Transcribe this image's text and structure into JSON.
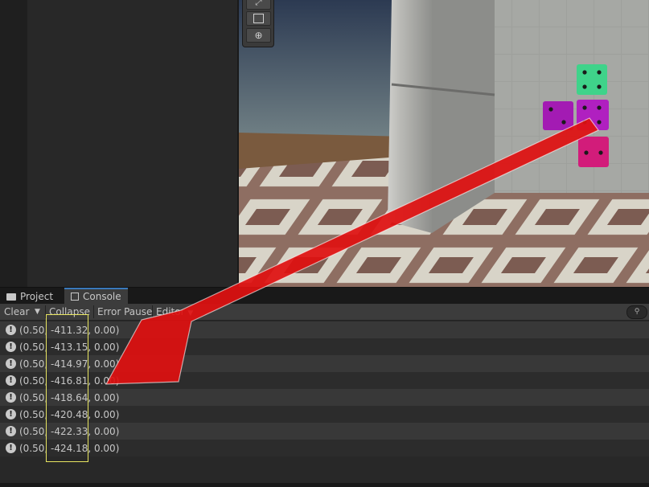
{
  "tabs": [
    {
      "label": "Project",
      "icon": "folder-icon"
    },
    {
      "label": "Console",
      "icon": "console-icon"
    }
  ],
  "toolbar": {
    "clear": "Clear",
    "collapse": "Collapse",
    "error_pause": "Error Pause",
    "editor": "Editor"
  },
  "log_entries": [
    "(0.50, -411.32, 0.00)",
    "(0.50, -413.15, 0.00)",
    "(0.50, -414.97, 0.00)",
    "(0.50, -416.81, 0.00)",
    "(0.50, -418.64, 0.00)",
    "(0.50, -420.48, 0.00)",
    "(0.50, -422.33, 0.00)",
    "(0.50, -424.18, 0.00)"
  ],
  "colors": {
    "annotation_arrow": "#e01010",
    "highlight_box": "#e8e560",
    "tab_accent": "#3a79bb",
    "dice_green": "#3fd38a",
    "dice_purple": "#b020c0",
    "dice_pink": "#d21c7a"
  }
}
